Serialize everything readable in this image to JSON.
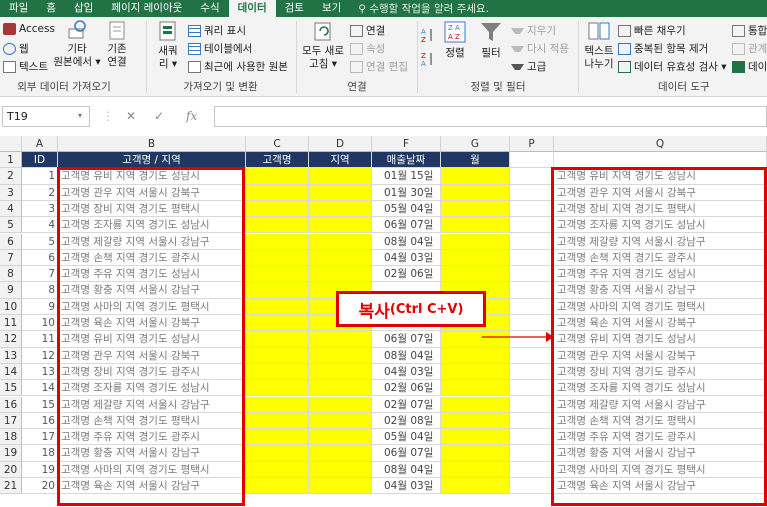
{
  "menu_tabs": [
    "파일",
    "홈",
    "삽입",
    "페이지 레이아웃",
    "수식",
    "데이터",
    "검토",
    "보기"
  ],
  "tell_me": "수행할 작업을 알려 주세요.",
  "ribbon": {
    "get_external": {
      "access": "Access",
      "web": "웹",
      "text": "텍스트",
      "other_line1": "기타",
      "other_line2": "원본에서 ▾",
      "existing_line1": "기존",
      "existing_line2": "연결",
      "title": "외부 데이터 가져오기"
    },
    "transform": {
      "new_query_line1": "새쿼",
      "new_query_line2": "리 ▾",
      "show_queries": "쿼리 표시",
      "from_table": "테이블에서",
      "recent_sources": "최근에 사용한 원본",
      "title": "가져오기 및 변환"
    },
    "connections": {
      "refresh_line1": "모두 새로",
      "refresh_line2": "고침 ▾",
      "connections": "연결",
      "properties": "속성",
      "edit_links": "연결 편집",
      "title": "연결"
    },
    "sort_filter": {
      "sort": "정렬",
      "filter": "필터",
      "clear": "지우기",
      "reapply": "다시 적용",
      "advanced": "고급",
      "title": "정렬 및 필터"
    },
    "data_tools": {
      "text_to_col_line1": "텍스트",
      "text_to_col_line2": "나누기",
      "flash_fill": "빠른 채우기",
      "remove_dup": "중복된 항목 제거",
      "validation": "데이터 유효성 검사 ▾",
      "consolidate": "통합",
      "relations": "관계",
      "manage": "데이",
      "title": "데이터 도구"
    }
  },
  "formula_bar": {
    "name_box": "T19",
    "fx": "fx"
  },
  "columns": [
    "A",
    "B",
    "C",
    "D",
    "F",
    "G",
    "P",
    "Q"
  ],
  "headers": {
    "id": "ID",
    "name_region": "고객명 / 지역",
    "name": "고객명",
    "region": "지역",
    "date": "매출날짜",
    "month": "월"
  },
  "rows": [
    {
      "n": "2",
      "id": "1",
      "b": "고객명 유비 지역 경기도 성남시",
      "f": "01월 15일",
      "q": "고객명 유비 지역 경기도 성남시"
    },
    {
      "n": "3",
      "id": "2",
      "b": "고객명 관우 지역 서울시 강북구",
      "f": "01월 30일",
      "q": "고객명 관우 지역 서울시 강북구"
    },
    {
      "n": "4",
      "id": "3",
      "b": "고객명 장비 지역 경기도 평택시",
      "f": "05월 04일",
      "q": "고객명 장비 지역 경기도 평택시"
    },
    {
      "n": "5",
      "id": "4",
      "b": "고객명 조자룡 지역 경기도 성남시",
      "f": "06월 07일",
      "q": "고객명 조자룡 지역 경기도 성남시"
    },
    {
      "n": "6",
      "id": "5",
      "b": "고객명 제갈량 지역 서울시 강남구",
      "f": "08월 04일",
      "q": "고객명 제갈량 지역 서울시 강남구"
    },
    {
      "n": "7",
      "id": "6",
      "b": "고객명 손책 지역 경기도 광주시",
      "f": "04월 03일",
      "q": "고객명 손책 지역 경기도 광주시"
    },
    {
      "n": "8",
      "id": "7",
      "b": "고객명 주유 지역 경기도 성남시",
      "f": "02월 06일",
      "q": "고객명 주유 지역 경기도 성남시"
    },
    {
      "n": "9",
      "id": "8",
      "b": "고객명 황충 지역 서울시 강남구",
      "f": "",
      "q": "고객명 황충 지역 서울시 강남구"
    },
    {
      "n": "10",
      "id": "9",
      "b": "고객명 사마의 지역 경기도 평택시",
      "f": "",
      "q": "고객명 사마의 지역 경기도 평택시"
    },
    {
      "n": "11",
      "id": "10",
      "b": "고객명 육손 지역 서울시 강북구",
      "f": "",
      "q": "고객명 육손 지역 서울시 강북구"
    },
    {
      "n": "12",
      "id": "11",
      "b": "고객명 유비 지역 경기도 성남시",
      "f": "06월 07일",
      "q": "고객명 유비 지역 경기도 성남시"
    },
    {
      "n": "13",
      "id": "12",
      "b": "고객명 관우 지역 서울시 강북구",
      "f": "08월 04일",
      "q": "고객명 관우 지역 서울시 강북구"
    },
    {
      "n": "14",
      "id": "13",
      "b": "고객명 장비 지역 경기도 광주시",
      "f": "04월 03일",
      "q": "고객명 장비 지역 경기도 광주시"
    },
    {
      "n": "15",
      "id": "14",
      "b": "고객명 조자룡 지역 경기도 성남시",
      "f": "02월 06일",
      "q": "고객명 조자룡 지역 경기도 성남시"
    },
    {
      "n": "16",
      "id": "15",
      "b": "고객명 제갈량 지역 서울시 강남구",
      "f": "02월 07일",
      "q": "고객명 제갈량 지역 서울시 강남구"
    },
    {
      "n": "17",
      "id": "16",
      "b": "고객명 손책 지역 경기도 평택시",
      "f": "02월 08일",
      "q": "고객명 손책 지역 경기도 평택시"
    },
    {
      "n": "18",
      "id": "17",
      "b": "고객명 주유 지역 경기도 광주시",
      "f": "05월 04일",
      "q": "고객명 주유 지역 경기도 광주시"
    },
    {
      "n": "19",
      "id": "18",
      "b": "고객명 황충 지역 서울시 강남구",
      "f": "06월 07일",
      "q": "고객명 황충 지역 서울시 강남구"
    },
    {
      "n": "20",
      "id": "19",
      "b": "고객명 사마의 지역 경기도 평택시",
      "f": "08월 04일",
      "q": "고객명 사마의 지역 경기도 평택시"
    },
    {
      "n": "21",
      "id": "20",
      "b": "고객명 육손 지역 서울시 강남구",
      "f": "04월 03일",
      "q": "고객명 육손 지역 서울시 강남구"
    }
  ],
  "header_row_num": "1",
  "callout": {
    "main": "복사",
    "sub": "(Ctrl C+V)"
  },
  "colors": {
    "accent": "#217346",
    "header_fill": "#203764",
    "highlight": "#ffff00",
    "annotation": "#e00000"
  }
}
